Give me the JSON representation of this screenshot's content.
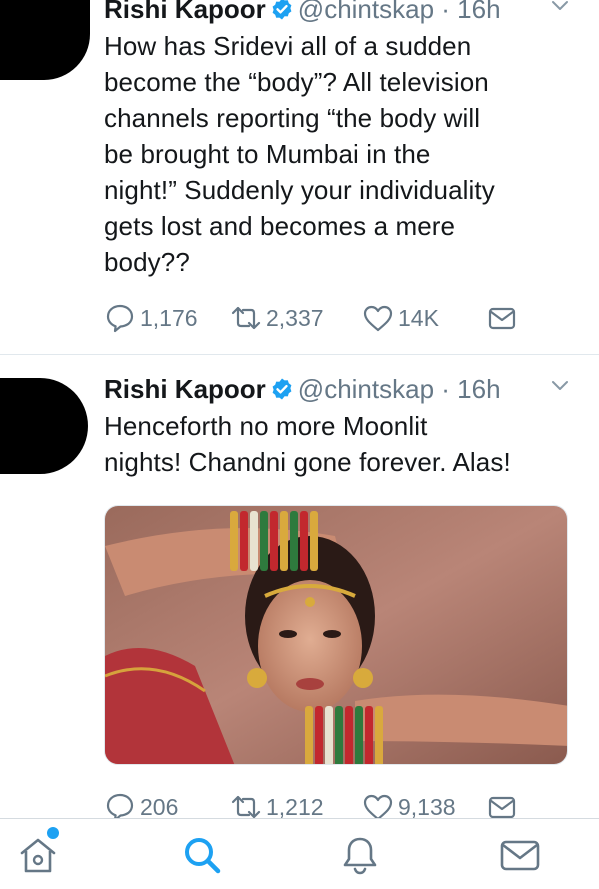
{
  "colors": {
    "text": "#14171a",
    "secondary": "#657786",
    "accent": "#1da1f2",
    "divider": "#e1e8ed"
  },
  "tweets": [
    {
      "author": "Rishi Kapoor",
      "verified": true,
      "handle": "@chintskap",
      "time": "· 16h",
      "text": "How has Sridevi all of a sudden\nbecome the “body”? All television\nchannels reporting  “the body will\nbe brought to Mumbai in the\nnight!” Suddenly your individuality\ngets lost and becomes a mere\nbody??",
      "replies": "1,176",
      "retweets": "2,337",
      "likes": "14K"
    },
    {
      "author": "Rishi Kapoor",
      "verified": true,
      "handle": "@chintskap",
      "time": "· 16h",
      "text": "Henceforth no more Moonlit\nnights! Chandni gone forever. Alas!",
      "media": "photo",
      "replies": "206",
      "retweets": "1,212",
      "likes": "9,138"
    }
  ],
  "tabbar": {
    "items": [
      "home-icon",
      "search-icon",
      "notifications-icon",
      "messages-icon"
    ],
    "active": "search-icon",
    "home_has_notification_dot": true
  }
}
